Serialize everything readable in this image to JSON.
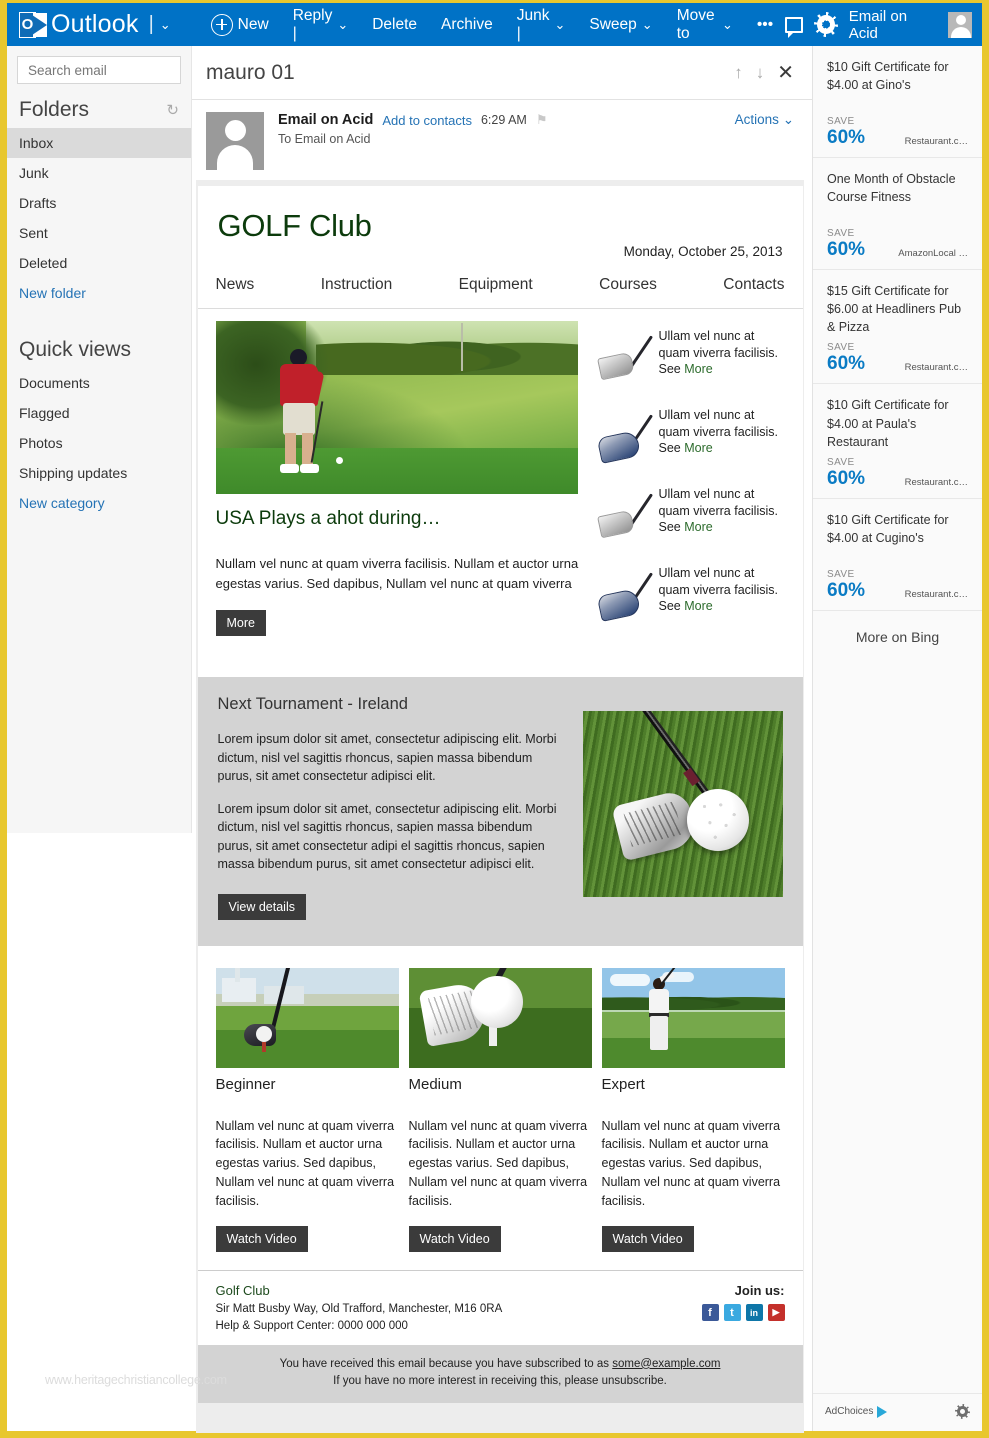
{
  "topbar": {
    "brand": "Outlook",
    "brand_chevron": "⌄",
    "new_label": "New",
    "items": [
      "Reply |",
      "Delete",
      "Archive",
      "Junk |",
      "Sweep",
      "Move to",
      "•••"
    ],
    "reply_label": "Reply |",
    "delete_label": "Delete",
    "archive_label": "Archive",
    "junk_label": "Junk |",
    "sweep_label": "Sweep",
    "moveto_label": "Move to",
    "more_label": "•••",
    "user": "Email on Acid",
    "accent": "#0072c6"
  },
  "sidebar": {
    "search_placeholder": "Search email",
    "folders_title": "Folders",
    "folders": [
      "Inbox",
      "Junk",
      "Drafts",
      "Sent",
      "Deleted"
    ],
    "new_folder": "New folder",
    "quickviews_title": "Quick views",
    "quickviews": [
      "Documents",
      "Flagged",
      "Photos",
      "Shipping updates"
    ],
    "new_category": "New category"
  },
  "reading": {
    "subject": "mauro 01",
    "from_name": "Email on Acid",
    "add_to_contacts": "Add to contacts",
    "time": "6:29 AM",
    "to_line": "To Email on Acid",
    "actions": "Actions"
  },
  "email": {
    "title": "GOLF Club",
    "date": "Monday, October 25, 2013",
    "nav": [
      "News",
      "Instruction",
      "Equipment",
      "Courses",
      "Contacts"
    ],
    "article": {
      "headline": "USA Plays a ahot during…",
      "body": "Nullam vel nunc at quam viverra facilisis. Nullam et auctor urna egestas varius. Sed dapibus, Nullam vel nunc at quam viverra",
      "button": "More"
    },
    "products": [
      {
        "text": "Ullam vel nunc at quam viverra facilisis. ",
        "see": "See ",
        "more": "More"
      },
      {
        "text": "Ullam vel nunc at quam viverra facilisis. ",
        "see": "See ",
        "more": "More"
      },
      {
        "text": "Ullam vel nunc at quam viverra facilisis. ",
        "see": "See ",
        "more": "More"
      },
      {
        "text": "Ullam vel nunc at quam viverra facilisis. ",
        "see": "See ",
        "more": "More"
      }
    ],
    "tournament": {
      "title": "Next Tournament - Ireland",
      "p1": "Lorem ipsum dolor sit amet, consectetur adipiscing elit. Morbi dictum, nisl vel sagittis rhoncus, sapien massa bibendum purus, sit amet consectetur adipisci elit.",
      "p2": "Lorem ipsum dolor sit amet, consectetur adipiscing elit. Morbi dictum, nisl vel sagittis rhoncus, sapien massa bibendum purus, sit amet consectetur adipi el sagittis rhoncus, sapien massa bibendum purus, sit amet consectetur adipisci elit.",
      "button": "View details"
    },
    "levels": [
      {
        "title": "Beginner",
        "text": "Nullam vel nunc at quam viverra facilisis. Nullam et auctor urna egestas varius. Sed dapibus, Nullam vel nunc at quam viverra facilisis.",
        "button": "Watch Video"
      },
      {
        "title": "Medium",
        "text": "Nullam vel nunc at quam viverra facilisis. Nullam et auctor urna egestas varius. Sed dapibus, Nullam vel nunc at quam viverra facilisis.",
        "button": "Watch Video"
      },
      {
        "title": "Expert",
        "text": "Nullam vel nunc at quam viverra facilisis. Nullam et auctor urna egestas varius. Sed dapibus, Nullam vel nunc at quam viverra facilisis.",
        "button": "Watch Video"
      }
    ],
    "footer": {
      "brand": "Golf Club",
      "address": "Sir Matt Busby Way, Old Trafford, Manchester, M16 0RA",
      "support": "Help & Support Center: 0000 000 000",
      "join": "Join us:",
      "socials": [
        "f",
        "t",
        "in",
        "▶"
      ],
      "unsub_line1_a": "You have received this email because you have subscribed to as ",
      "unsub_email": "some@example.com",
      "unsub_line2": "If you have no more interest in receiving this, please unsubscribe."
    }
  },
  "ads": {
    "items": [
      {
        "title": "$10 Gift Certificate for $4.00 at Gino's",
        "save": "SAVE",
        "pct": "60%",
        "source": "Restaurant.c…"
      },
      {
        "title": "One Month of Obstacle Course Fitness",
        "save": "SAVE",
        "pct": "60%",
        "source": "AmazonLocal …"
      },
      {
        "title": "$15 Gift Certificate for $6.00 at Headliners Pub & Pizza",
        "save": "SAVE",
        "pct": "60%",
        "source": "Restaurant.c…"
      },
      {
        "title": "$10 Gift Certificate for $4.00 at Paula's Restaurant",
        "save": "SAVE",
        "pct": "60%",
        "source": "Restaurant.c…"
      },
      {
        "title": "$10 Gift Certificate for $4.00 at Cugino's",
        "save": "SAVE",
        "pct": "60%",
        "source": "Restaurant.c…"
      }
    ],
    "more_on_bing": "More on Bing",
    "adchoices": "AdChoices"
  },
  "watermark": "www.heritagechristiancollege.com"
}
